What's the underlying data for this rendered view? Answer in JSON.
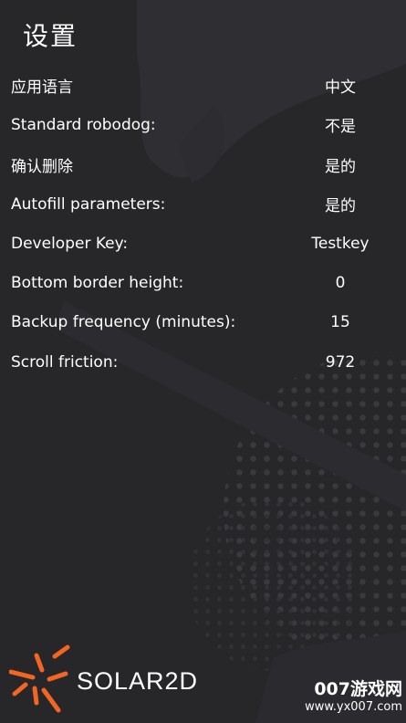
{
  "screen": {
    "title": "设置"
  },
  "settings": [
    {
      "label": "应用语言",
      "value": "中文"
    },
    {
      "label": "Standard robodog:",
      "value": "不是"
    },
    {
      "label": "确认删除",
      "value": "是的"
    },
    {
      "label": "Autofill parameters:",
      "value": "是的"
    },
    {
      "label": "Developer Key:",
      "value": "Testkey"
    },
    {
      "label": "Bottom border height:",
      "value": "0"
    },
    {
      "label": "Backup frequency (minutes):",
      "value": "15"
    },
    {
      "label": "Scroll friction:",
      "value": "972"
    }
  ],
  "branding": {
    "logo_text": "SOLAR2D"
  },
  "watermark": {
    "top": "007游戏网",
    "bottom": "www.yx007.com"
  },
  "colors": {
    "background": "#27272a",
    "text": "#ffffff",
    "logo_accent": "#f26522"
  },
  "icons": {
    "logo": "solar2d-sunburst-icon"
  }
}
